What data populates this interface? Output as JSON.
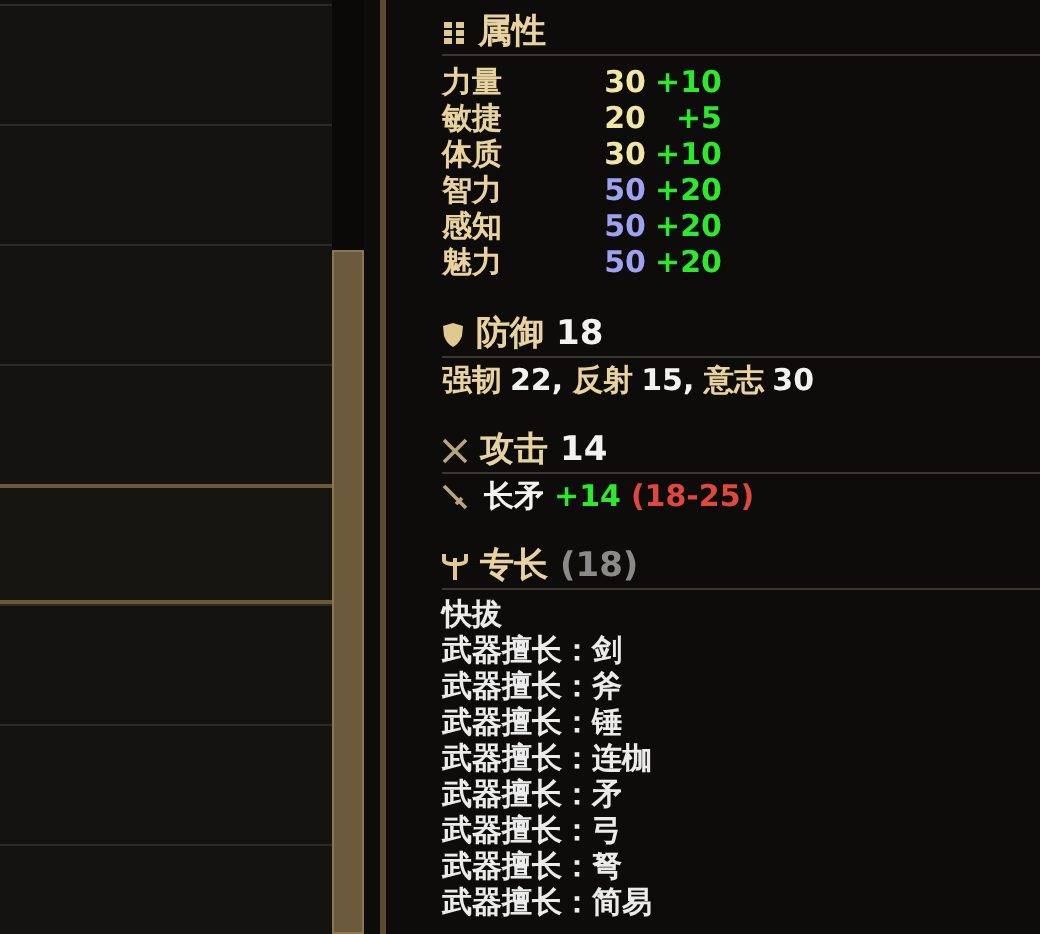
{
  "list": {
    "rows": [
      {
        "selected": false
      },
      {
        "selected": false
      },
      {
        "selected": false
      },
      {
        "selected": false
      },
      {
        "selected": true
      },
      {
        "selected": false
      },
      {
        "selected": false
      },
      {
        "selected": false
      }
    ]
  },
  "attributes": {
    "title": "属性",
    "rows": [
      {
        "name": "力量",
        "value": "30",
        "bonus": "+10",
        "color": "#f0e6a6"
      },
      {
        "name": "敏捷",
        "value": "20",
        "bonus": "+5",
        "color": "#f0e6a6"
      },
      {
        "name": "体质",
        "value": "30",
        "bonus": "+10",
        "color": "#f0e6a6"
      },
      {
        "name": "智力",
        "value": "50",
        "bonus": "+20",
        "color": "#9ea2f2"
      },
      {
        "name": "感知",
        "value": "50",
        "bonus": "+20",
        "color": "#9ea2f2"
      },
      {
        "name": "魅力",
        "value": "50",
        "bonus": "+20",
        "color": "#9ea2f2"
      }
    ]
  },
  "defense": {
    "title": "防御",
    "value": "18",
    "parts": [
      {
        "label": "强韧",
        "value": "22,"
      },
      {
        "label": "反射",
        "value": "15,"
      },
      {
        "label": "意志",
        "value": "30"
      }
    ]
  },
  "attack": {
    "title": "攻击",
    "value": "14",
    "weapons": [
      {
        "name": "长矛",
        "bonus": "+14",
        "damage": "(18-25)"
      }
    ]
  },
  "perks": {
    "title": "专长",
    "count": "(18)",
    "items": [
      "快拔",
      "武器擅长：剑",
      "武器擅长：斧",
      "武器擅长：锤",
      "武器擅长：连枷",
      "武器擅长：矛",
      "武器擅长：弓",
      "武器擅长：弩",
      "武器擅长：简易"
    ]
  }
}
